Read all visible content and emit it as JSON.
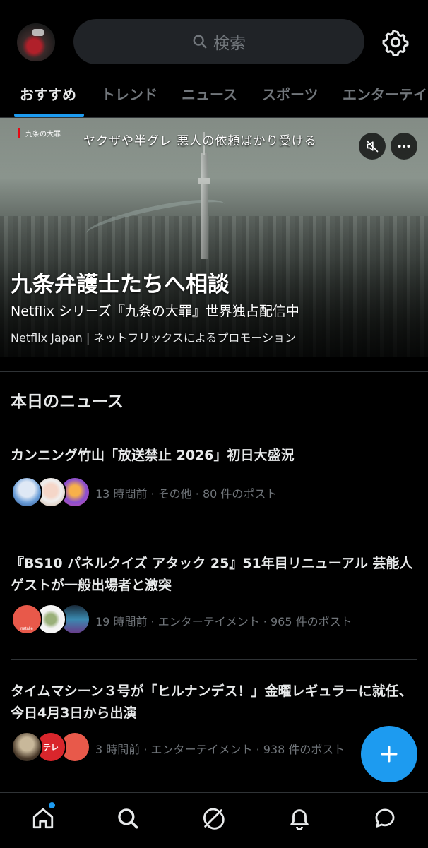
{
  "header": {
    "search_placeholder": "検索"
  },
  "tabs": [
    {
      "label": "おすすめ",
      "active": true
    },
    {
      "label": "トレンド",
      "active": false
    },
    {
      "label": "ニュース",
      "active": false
    },
    {
      "label": "スポーツ",
      "active": false
    },
    {
      "label": "エンターテイ",
      "active": false
    }
  ],
  "hero": {
    "tag": "九条の大罪",
    "overlay_text": "ヤクザや半グレ 悪人の依頼ばかり受ける",
    "title": "九条弁護士たちへ相談",
    "subtitle": "Netflix シリーズ『九条の大罪』世界独占配信中",
    "promo": "Netflix Japan | ネットフリックスによるプロモーション"
  },
  "news": {
    "section_title": "本日のニュース",
    "items": [
      {
        "headline": "カンニング竹山「放送禁止 2026」初日大盛況",
        "meta": "13 時間前 · その他 · 80 件のポスト"
      },
      {
        "headline": "『BS10 パネルクイズ アタック 25』51年目リニューアル 芸能人ゲストが一般出場者と激突",
        "meta": "19 時間前 · エンターテイメント · 965 件のポスト"
      },
      {
        "headline": "タイムマシーン３号が「ヒルナンデス！」金曜レギュラーに就任、今日4月3日から出演",
        "meta": "3 時間前 · エンターテイメント · 938 件のポスト"
      }
    ]
  },
  "avatar_text": {
    "natalie": "natalie",
    "tele": "テレ"
  },
  "colors": {
    "accent": "#1d9bf0",
    "background": "#000000",
    "text_primary": "#e7e9ea",
    "text_secondary": "#71767b"
  },
  "icons": [
    "search-icon",
    "gear-icon",
    "mute-icon",
    "more-icon",
    "plus-icon",
    "home-icon",
    "explore-icon",
    "grok-icon",
    "bell-icon",
    "message-icon"
  ]
}
